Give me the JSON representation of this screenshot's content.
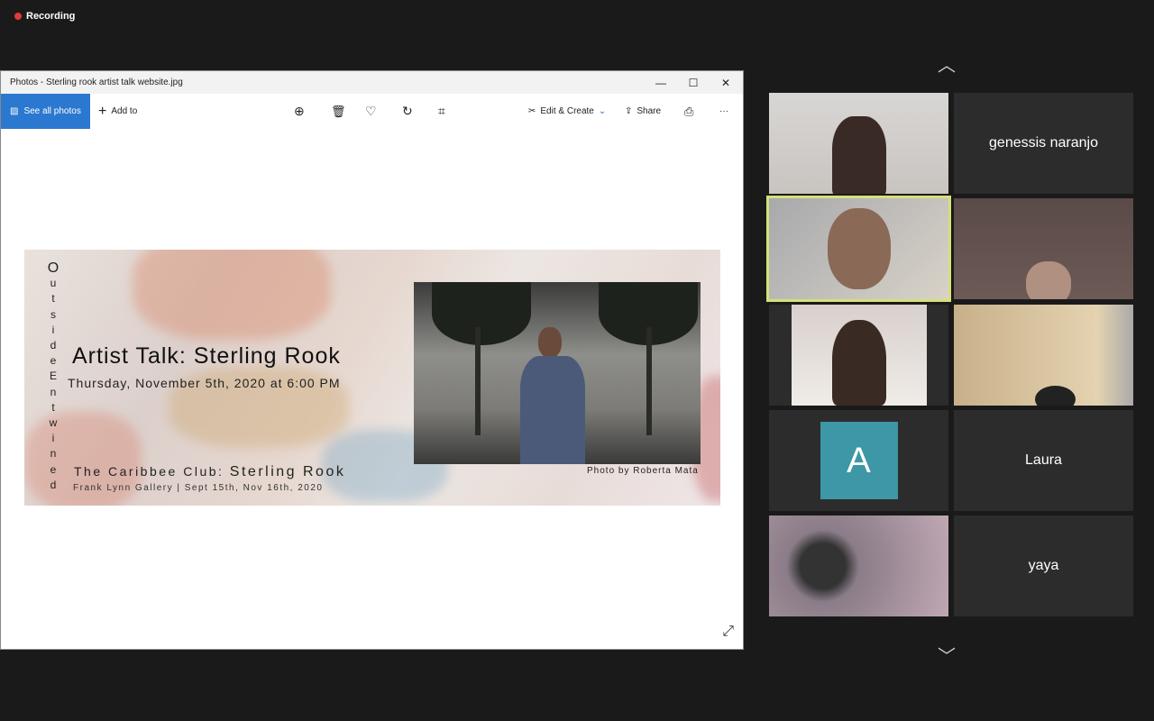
{
  "recording": {
    "label": "Recording"
  },
  "window": {
    "title": "Photos - Sterling rook artist talk website.jpg"
  },
  "toolbar": {
    "see_all": "See all photos",
    "add_to": "Add to",
    "edit_create": "Edit & Create",
    "share": "Share",
    "more": "···"
  },
  "poster": {
    "vertical_text": [
      "O",
      "u",
      "t",
      "s",
      "i",
      "d",
      "e",
      "E",
      "n",
      "t",
      "w",
      "i",
      "n",
      "e",
      "d"
    ],
    "title": "Artist Talk: Sterling Rook",
    "datetime": "Thursday, November 5th, 2020 at 6:00 PM",
    "exhibit_prefix": "The Caribbee Club: ",
    "exhibit_artist": "Sterling Rook",
    "gallery": "Frank Lynn Gallery | Sept 15th, Nov 16th, 2020",
    "credit": "Photo by Roberta Mata"
  },
  "participants": [
    {
      "name": "genessis naranjo"
    },
    {
      "initial": "A",
      "color": "#3d97a6"
    },
    {
      "name": "Laura"
    },
    {
      "name": "yaya"
    }
  ],
  "colors": {
    "accent": "#2b78d0",
    "active_speaker": "#d6e07a"
  }
}
